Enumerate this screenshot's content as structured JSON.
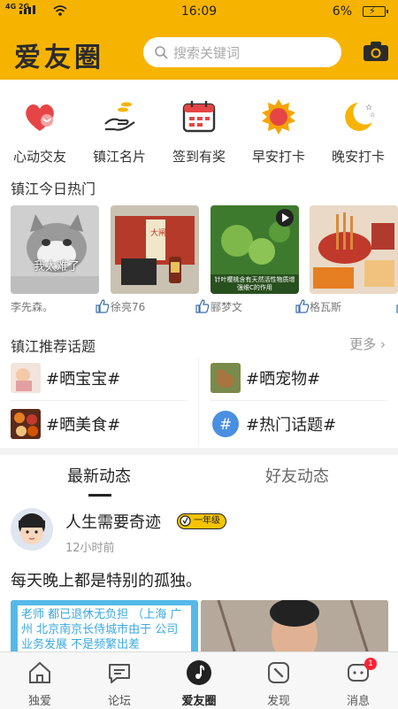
{
  "status_bar": {
    "network": "4G 2G",
    "time": "16:09",
    "battery": "6%"
  },
  "header": {
    "logo": "爱友圈",
    "search_placeholder": "搜索关键词"
  },
  "quick_actions": [
    {
      "label": "心动交友",
      "icon": "heart-icon"
    },
    {
      "label": "镇江名片",
      "icon": "hand-coins-icon"
    },
    {
      "label": "签到有奖",
      "icon": "calendar-icon"
    },
    {
      "label": "早安打卡",
      "icon": "sun-icon"
    },
    {
      "label": "晚安打卡",
      "icon": "moon-icon"
    }
  ],
  "hot_section": {
    "title": "镇江今日热门",
    "cards": [
      {
        "author": "李先森。",
        "caption": "我太难了"
      },
      {
        "author": "徐亮76",
        "caption": "大闸蟹"
      },
      {
        "author": "郦梦文",
        "caption": "针叶樱桃含有天然活性物质增强维C的作用"
      },
      {
        "author": "格瓦斯",
        "caption": ""
      }
    ]
  },
  "topic_section": {
    "title": "镇江推荐话题",
    "more": "更多",
    "topics": [
      {
        "label": "#晒宝宝#"
      },
      {
        "label": "#晒宠物#"
      },
      {
        "label": "#晒美食#"
      },
      {
        "label": "#热门话题#"
      }
    ]
  },
  "feed_tabs": [
    {
      "label": "最新动态"
    },
    {
      "label": "好友动态"
    }
  ],
  "post": {
    "username": "人生需要奇迹",
    "badge": "一年级",
    "time": "12小时前",
    "text": "每天晚上都是特别的孤独。",
    "image1_text": "老师 都已退休无负担 （上海 广州 北京南京长侍城市由于 公司业务发展 不是频繁出差"
  },
  "bottom_nav": [
    {
      "label": "独爱",
      "icon": "home-icon"
    },
    {
      "label": "论坛",
      "icon": "chat-icon"
    },
    {
      "label": "爱友圈",
      "icon": "music-note-icon"
    },
    {
      "label": "发现",
      "icon": "compass-icon"
    },
    {
      "label": "消息",
      "icon": "message-icon",
      "badge": "1"
    }
  ],
  "colors": {
    "brand": "#f6b400",
    "accent_red": "#e64545"
  }
}
